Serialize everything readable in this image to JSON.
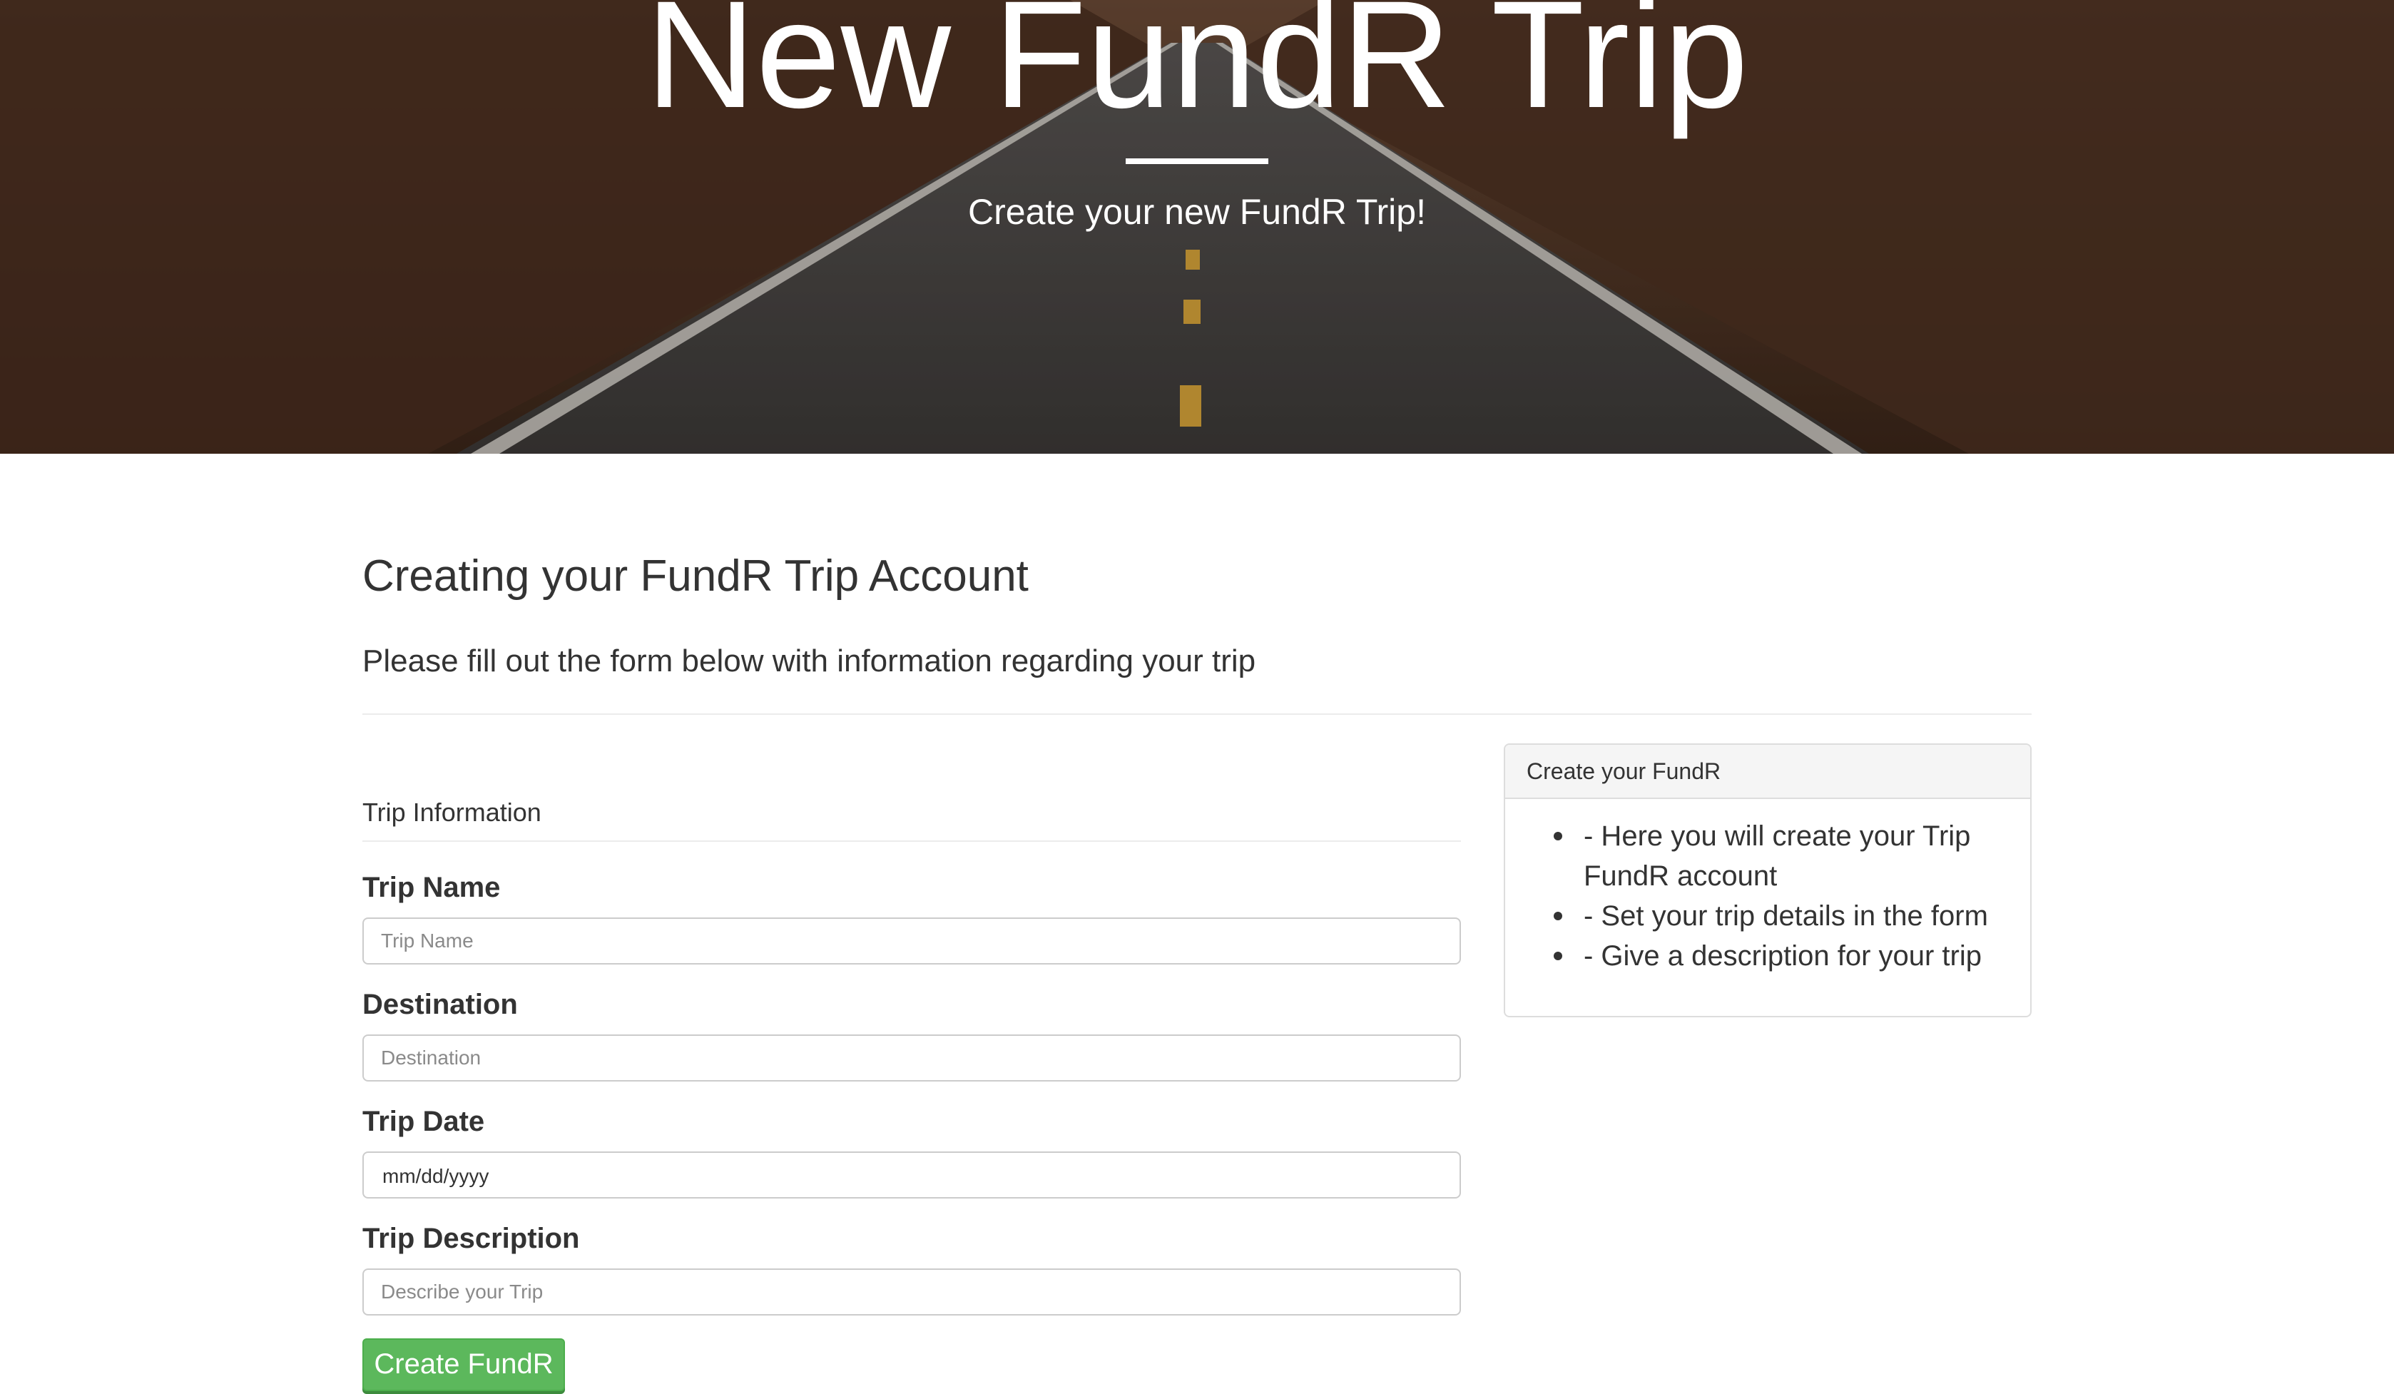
{
  "hero": {
    "title": "New FundR Trip",
    "subtitle": "Create your new FundR Trip!"
  },
  "main": {
    "heading": "Creating your FundR Trip Account",
    "lead": "Please fill out the form below with information regarding your trip"
  },
  "form": {
    "legend": "Trip Information",
    "fields": [
      {
        "label": "Trip Name",
        "placeholder": "Trip Name"
      },
      {
        "label": "Destination",
        "placeholder": "Destination"
      },
      {
        "label": "Trip Date",
        "value": "mm/dd/yyyy"
      },
      {
        "label": "Trip Description",
        "placeholder": "Describe your Trip"
      }
    ],
    "submit_label": "Create FundR"
  },
  "sidebar": {
    "title": "Create your FundR",
    "items": [
      "- Here you will create your Trip FundR account",
      "- Set your trip details in the form",
      "- Give a description for your trip"
    ]
  },
  "colors": {
    "button_green": "#5cb85c",
    "text": "#333333",
    "panel_heading_bg": "#f5f5f5"
  }
}
